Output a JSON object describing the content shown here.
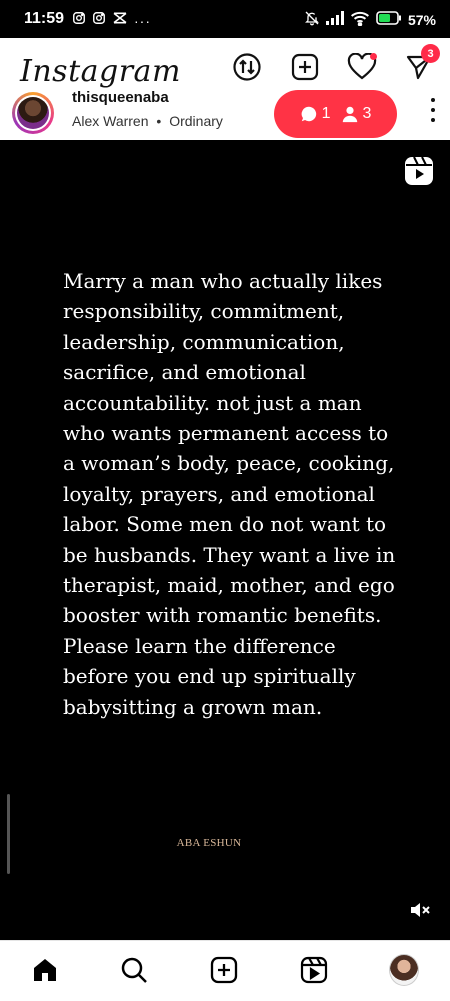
{
  "status_bar": {
    "time": "11:59",
    "battery": "57%",
    "left_icons": [
      "instagram-icon",
      "instagram-icon",
      "capcut-icon",
      "more-dots-icon"
    ],
    "right_icons": [
      "mute-bell-icon",
      "signal-icon",
      "wifi-icon",
      "battery-icon"
    ]
  },
  "header": {
    "logo": "Instagram",
    "actions": [
      {
        "name": "sync-icon"
      },
      {
        "name": "add-post-icon"
      },
      {
        "name": "heart-icon",
        "has_dot": true
      },
      {
        "name": "direct-message-icon",
        "badge": "3"
      }
    ]
  },
  "post": {
    "username": "thisqueenaba",
    "music_artist": "Alex Warren",
    "music_title": "Ordinary",
    "separator": "•"
  },
  "notification_pill": {
    "comments": "1",
    "follows": "3",
    "color": "#ff3345"
  },
  "reel": {
    "quote": "Marry a man who actually likes responsibility, commitment, leadership, communication, sacrifice, and emotional accountability. not just a man who wants permanent access to a woman’s body, peace, cooking, loyalty, prayers, and emotional labor. Some men do not want to be husbands. They want a live in therapist, maid, mother, and ego booster with romantic benefits. Please learn the difference before you end up spiritually babysitting a grown man.",
    "author": "ABA ESHUN",
    "author_color": "#d9b89a",
    "background": "#000000",
    "sound": "muted"
  },
  "navbar": {
    "items": [
      "home-icon",
      "search-icon",
      "create-icon",
      "reels-icon",
      "profile-avatar"
    ]
  }
}
